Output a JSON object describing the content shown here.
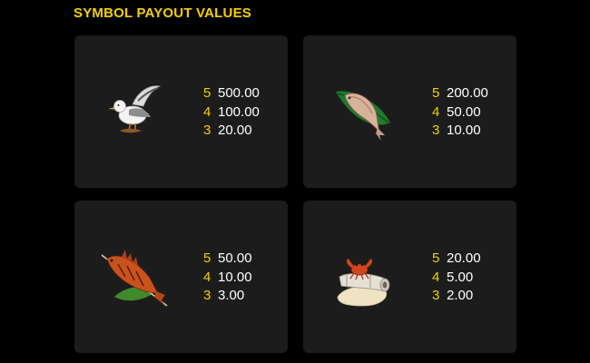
{
  "title": "SYMBOL PAYOUT VALUES",
  "colors": {
    "background": "#000000",
    "card": "#1c1c1c",
    "accent": "#f5d000",
    "value_text": "#ffffff"
  },
  "cards": [
    {
      "symbol": "seagull-icon",
      "pays": [
        {
          "count": "5",
          "value": "500.00"
        },
        {
          "count": "4",
          "value": "100.00"
        },
        {
          "count": "3",
          "value": "20.00"
        }
      ]
    },
    {
      "symbol": "fish-on-leaf-icon",
      "pays": [
        {
          "count": "5",
          "value": "200.00"
        },
        {
          "count": "4",
          "value": "50.00"
        },
        {
          "count": "3",
          "value": "10.00"
        }
      ]
    },
    {
      "symbol": "grilled-fish-icon",
      "pays": [
        {
          "count": "5",
          "value": "50.00"
        },
        {
          "count": "4",
          "value": "10.00"
        },
        {
          "count": "3",
          "value": "3.00"
        }
      ]
    },
    {
      "symbol": "crab-on-cannon-icon",
      "pays": [
        {
          "count": "5",
          "value": "20.00"
        },
        {
          "count": "4",
          "value": "5.00"
        },
        {
          "count": "3",
          "value": "2.00"
        }
      ]
    }
  ]
}
